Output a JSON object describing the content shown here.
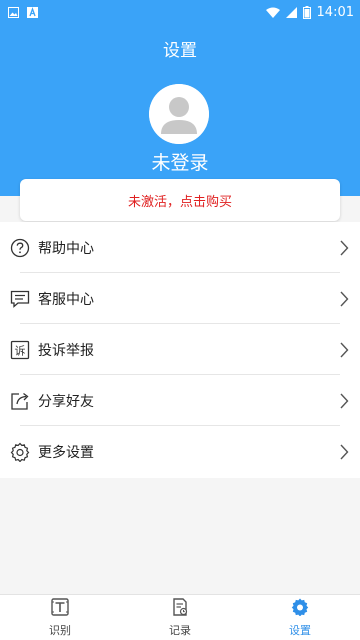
{
  "status_bar": {
    "time": "14:01",
    "left_icons": [
      "image-icon",
      "a-icon"
    ],
    "right_icons": [
      "wifi-icon",
      "signal-icon",
      "battery-icon"
    ]
  },
  "header": {
    "title": "设置",
    "username": "未登录",
    "avatar_icon": "user-avatar-icon"
  },
  "activate_card": {
    "text": "未激活，点击购买"
  },
  "menu": {
    "items": [
      {
        "label": "帮助中心",
        "icon": "help-icon"
      },
      {
        "label": "客服中心",
        "icon": "chat-icon"
      },
      {
        "label": "投诉举报",
        "icon": "complaint-icon"
      },
      {
        "label": "分享好友",
        "icon": "share-icon"
      },
      {
        "label": "更多设置",
        "icon": "gear-icon"
      }
    ]
  },
  "bottom_nav": {
    "items": [
      {
        "label": "识别",
        "icon": "recognize-icon",
        "active": false
      },
      {
        "label": "记录",
        "icon": "record-icon",
        "active": false
      },
      {
        "label": "设置",
        "icon": "settings-icon",
        "active": true
      }
    ]
  },
  "colors": {
    "primary": "#3aa3f8",
    "active_tab": "#2f8fe8",
    "warning_text": "#e02020",
    "background": "#f5f5f5"
  }
}
